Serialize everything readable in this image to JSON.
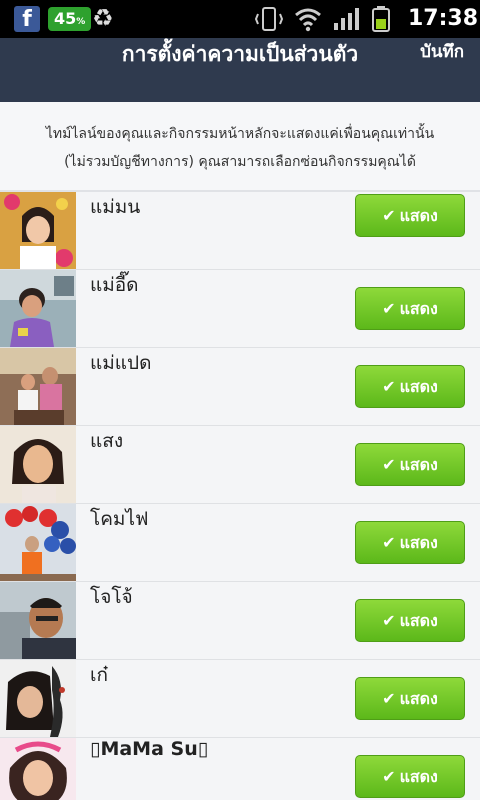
{
  "status_bar": {
    "battery_app": "45",
    "time": "17:38"
  },
  "header": {
    "title": "การตั้งค่าความเป็นส่วนตัว",
    "save": "บันทึก"
  },
  "description": {
    "line1": "ไทม์ไลน์ของคุณและกิจกรรมหน้าหลักจะแสดงแค่เพื่อนคุณเท่านั้น",
    "line2": "(ไม่รวมบัญชีทางการ) คุณสามารถเลือกซ่อนกิจกรรมคุณได้"
  },
  "friends": [
    {
      "name": "แม่มน",
      "button": "แสดง"
    },
    {
      "name": "แม่อี๊ด",
      "button": "แสดง"
    },
    {
      "name": "แม่แปด",
      "button": "แสดง"
    },
    {
      "name": "แสง",
      "button": "แสดง"
    },
    {
      "name": "โคมไฟ",
      "button": "แสดง"
    },
    {
      "name": "โจโจ้",
      "button": "แสดง"
    },
    {
      "name": "เก๋",
      "button": "แสดง"
    },
    {
      "name": "▯MaMa Su▯",
      "button": "แสดง"
    }
  ],
  "colors": {
    "header_bg": "#2f3a4e",
    "button_green": "#6cc823"
  }
}
